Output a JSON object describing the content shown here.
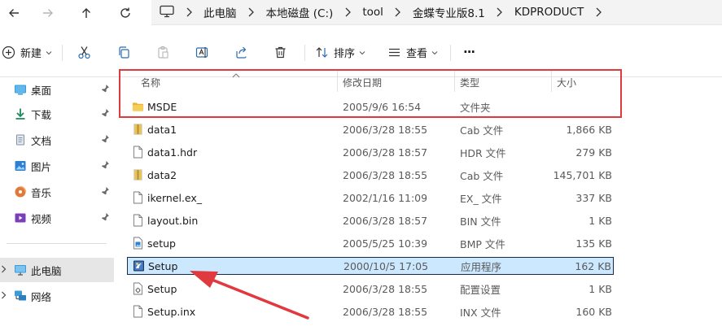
{
  "address_bar": {
    "crumbs": [
      "此电脑",
      "本地磁盘 (C:)",
      "tool",
      "金蝶专业版8.1",
      "KDPRODUCT"
    ]
  },
  "toolbar": {
    "new_label": "新建",
    "sort_label": "排序",
    "view_label": "查看",
    "more_label": "···"
  },
  "sidebar": {
    "items": [
      {
        "label": "桌面",
        "icon": "desktop-icon"
      },
      {
        "label": "下载",
        "icon": "download-icon"
      },
      {
        "label": "文档",
        "icon": "documents-icon"
      },
      {
        "label": "图片",
        "icon": "pictures-icon"
      },
      {
        "label": "音乐",
        "icon": "music-icon"
      },
      {
        "label": "视频",
        "icon": "videos-icon"
      }
    ],
    "this_pc": "此电脑",
    "network": "网络"
  },
  "columns": {
    "name": "名称",
    "modified": "修改日期",
    "type": "类型",
    "size": "大小"
  },
  "files": [
    {
      "name": "MSDE",
      "modified": "2005/9/6 16:54",
      "type": "文件夹",
      "size": "",
      "icon": "folder-icon"
    },
    {
      "name": "data1",
      "modified": "2006/3/28 18:55",
      "type": "Cab 文件",
      "size": "1,866 KB",
      "icon": "cab-file-icon"
    },
    {
      "name": "data1.hdr",
      "modified": "2006/3/28 18:57",
      "type": "HDR 文件",
      "size": "279 KB",
      "icon": "file-icon"
    },
    {
      "name": "data2",
      "modified": "2006/3/28 18:55",
      "type": "Cab 文件",
      "size": "145,701 KB",
      "icon": "cab-file-icon"
    },
    {
      "name": "ikernel.ex_",
      "modified": "2002/1/16 11:09",
      "type": "EX_ 文件",
      "size": "337 KB",
      "icon": "file-icon"
    },
    {
      "name": "layout.bin",
      "modified": "2006/3/28 18:57",
      "type": "BIN 文件",
      "size": "1 KB",
      "icon": "file-icon"
    },
    {
      "name": "setup",
      "modified": "2005/5/25 10:39",
      "type": "BMP 文件",
      "size": "135 KB",
      "icon": "bitmap-icon"
    },
    {
      "name": "Setup",
      "modified": "2000/10/5 17:05",
      "type": "应用程序",
      "size": "162 KB",
      "icon": "setup-app-icon"
    },
    {
      "name": "Setup",
      "modified": "2006/3/28 18:55",
      "type": "配置设置",
      "size": "1 KB",
      "icon": "config-settings-icon"
    },
    {
      "name": "Setup.inx",
      "modified": "2006/3/28 18:55",
      "type": "INX 文件",
      "size": "160 KB",
      "icon": "file-icon"
    }
  ],
  "colors": {
    "selection_bg": "#cce8ff",
    "annotation_red": "#e0393e",
    "folder_yellow": "#f5c342"
  }
}
